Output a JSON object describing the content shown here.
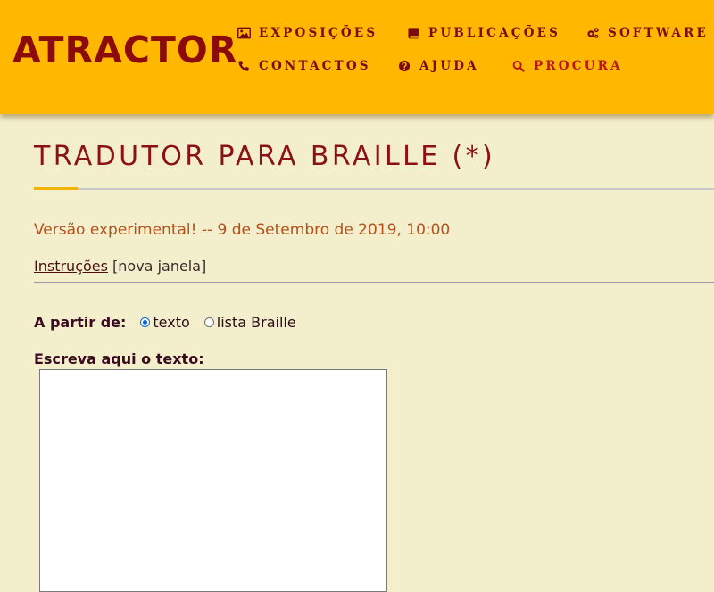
{
  "header": {
    "logo": "ATRACTOR",
    "nav": {
      "exposicoes": "EXPOSIÇÕES",
      "publicacoes": "PUBLICAÇÕES",
      "software": "SOFTWARE",
      "contactos": "CONTACTOS",
      "ajuda": "AJUDA",
      "procura": "PROCURA"
    },
    "icons": {
      "exposicoes": "image-icon",
      "publicacoes": "book-icon",
      "software": "cogs-icon",
      "contactos": "phone-icon",
      "ajuda": "question-circle-icon",
      "procura": "search-icon"
    }
  },
  "main": {
    "title": "TRADUTOR PARA BRAILLE (*)",
    "version": "Versão experimental! -- 9 de Setembro de 2019, 10:00",
    "instructions_link": "Instruções",
    "instructions_note": " [nova janela]",
    "from_label": "A partir de:",
    "options": [
      {
        "label": "texto",
        "selected": true
      },
      {
        "label": "lista Braille",
        "selected": false
      }
    ],
    "write_label": "Escreva aqui o texto:",
    "input_text": ""
  },
  "colors": {
    "header_bg": "#ffb700",
    "page_bg": "#f3efcd",
    "logo": "#8b0a0a",
    "title": "#8b1018",
    "version": "#b5501a",
    "accent": "#f2b300"
  }
}
